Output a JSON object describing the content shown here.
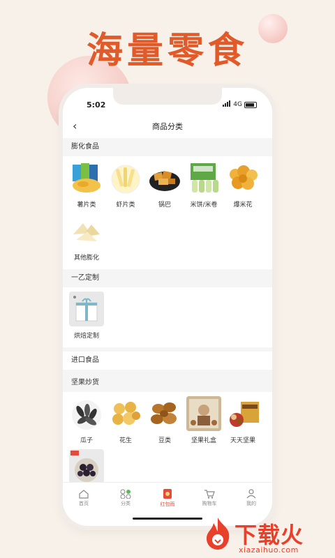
{
  "headline": "海量零食",
  "status_bar": {
    "time": "5:02",
    "network": "4G"
  },
  "nav": {
    "title": "商品分类"
  },
  "sections": [
    {
      "title": "膨化食品",
      "items": [
        {
          "label": "薯片类",
          "icon": "chips-image"
        },
        {
          "label": "虾片类",
          "icon": "shrimp-chips-image"
        },
        {
          "label": "锅巴",
          "icon": "guoba-image"
        },
        {
          "label": "米饼/米卷",
          "icon": "rice-cracker-image"
        },
        {
          "label": "爆米花",
          "icon": "popcorn-image"
        },
        {
          "label": "其他膨化",
          "icon": "other-puffed-image"
        }
      ]
    },
    {
      "title": "一乙定制",
      "items": [
        {
          "label": "烘焙定制",
          "icon": "cake-box-image"
        }
      ]
    },
    {
      "title": "进口食品",
      "items": []
    },
    {
      "title": "坚果炒货",
      "items": [
        {
          "label": "瓜子",
          "icon": "sunflower-seeds-image"
        },
        {
          "label": "花生",
          "icon": "peanut-image"
        },
        {
          "label": "豆类",
          "icon": "beans-image"
        },
        {
          "label": "坚果礼盒",
          "icon": "nut-gift-box-image"
        },
        {
          "label": "天天坚果",
          "icon": "daily-nuts-image"
        },
        {
          "label": "",
          "icon": "raisins-image"
        }
      ]
    }
  ],
  "tabbar": [
    {
      "label": "首页",
      "icon": "home-icon",
      "active": false
    },
    {
      "label": "分类",
      "icon": "category-icon",
      "active": false
    },
    {
      "label": "红包雨",
      "icon": "red-packet-icon",
      "active": true
    },
    {
      "label": "购物车",
      "icon": "cart-icon",
      "active": false
    },
    {
      "label": "我的",
      "icon": "profile-icon",
      "active": false
    }
  ],
  "watermark": {
    "text": "下载火",
    "url": "xiazaihuo.com"
  },
  "colors": {
    "accent": "#e05a2a",
    "tab_active": "#e64a3b",
    "background": "#f8f1ea"
  }
}
